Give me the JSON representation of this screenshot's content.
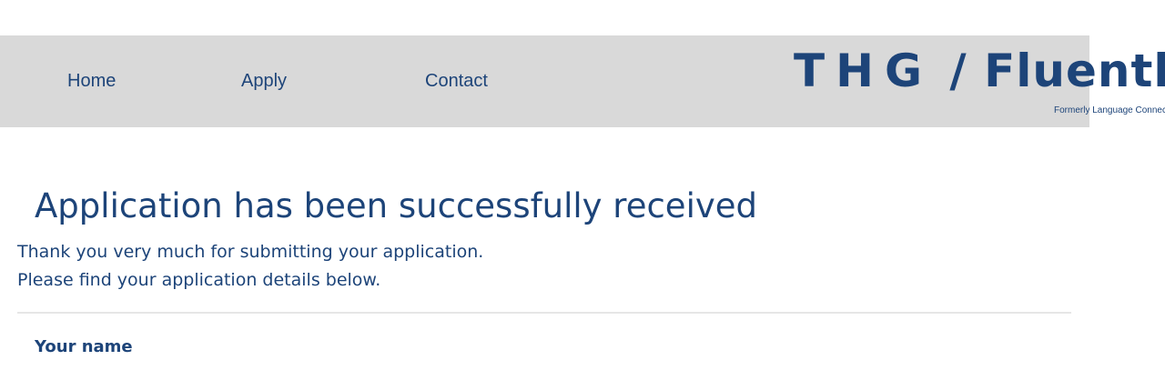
{
  "nav": {
    "items": [
      {
        "label": "Home"
      },
      {
        "label": "Apply"
      },
      {
        "label": "Contact"
      }
    ]
  },
  "logo": {
    "brand_left": "THG",
    "separator": "/",
    "brand_right": "Fluently",
    "subtitle": "Formerly Language Connect"
  },
  "main": {
    "title": "Application has been successfully received",
    "line1": "Thank you very much for submitting your application.",
    "line2": "Please find your application details below.",
    "fields": [
      {
        "label": "Your name"
      }
    ]
  },
  "colors": {
    "brand": "#1d4479",
    "nav_background": "#d9d9d9",
    "divider": "#e6e6e6"
  }
}
